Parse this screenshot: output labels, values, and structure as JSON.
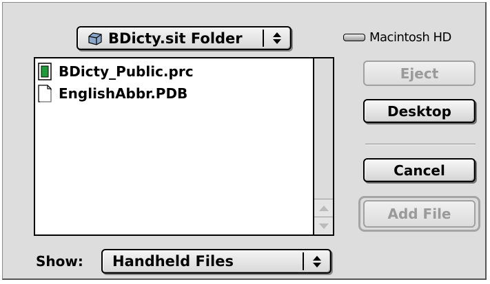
{
  "folder_popup": {
    "label": "BDicty.sit Folder",
    "icon": "folder-icon"
  },
  "volume": {
    "name": "Macintosh HD",
    "icon": "hard-drive-icon"
  },
  "files": [
    {
      "name": "BDicty_Public.prc",
      "icon": "palm-app-icon"
    },
    {
      "name": "EnglishAbbr.PDB",
      "icon": "document-icon"
    }
  ],
  "buttons": {
    "eject": "Eject",
    "desktop": "Desktop",
    "cancel": "Cancel",
    "add_file": "Add File"
  },
  "show": {
    "label": "Show:",
    "selected": "Handheld Files"
  }
}
